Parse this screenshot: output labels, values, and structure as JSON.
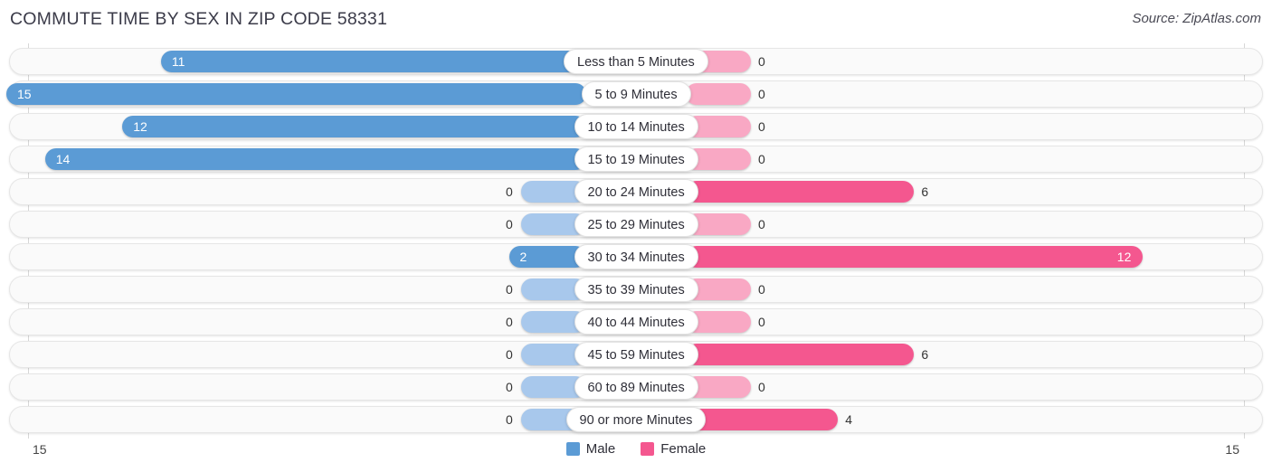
{
  "header": {
    "title": "COMMUTE TIME BY SEX IN ZIP CODE 58331",
    "source": "Source: ZipAtlas.com"
  },
  "legend": {
    "male_label": "Male",
    "female_label": "Female",
    "male_color": "#5B9BD5",
    "female_color": "#F4578F",
    "male_zero_color": "#A8C8EC",
    "female_zero_color": "#F9A8C4"
  },
  "axis": {
    "left_label": "15",
    "right_label": "15",
    "max": 15
  },
  "chart_data": {
    "type": "bar",
    "orientation": "horizontal-diverging",
    "title": "COMMUTE TIME BY SEX IN ZIP CODE 58331",
    "xlabel": "",
    "ylabel": "",
    "xlim": [
      15,
      15
    ],
    "grid": false,
    "legend_position": "bottom-center",
    "categories": [
      "Less than 5 Minutes",
      "5 to 9 Minutes",
      "10 to 14 Minutes",
      "15 to 19 Minutes",
      "20 to 24 Minutes",
      "25 to 29 Minutes",
      "30 to 34 Minutes",
      "35 to 39 Minutes",
      "40 to 44 Minutes",
      "45 to 59 Minutes",
      "60 to 89 Minutes",
      "90 or more Minutes"
    ],
    "series": [
      {
        "name": "Male",
        "values": [
          11,
          15,
          12,
          14,
          0,
          0,
          2,
          0,
          0,
          0,
          0,
          0
        ]
      },
      {
        "name": "Female",
        "values": [
          0,
          0,
          0,
          0,
          6,
          0,
          12,
          0,
          0,
          6,
          0,
          4
        ]
      }
    ]
  },
  "rows": [
    {
      "label": "Less than 5 Minutes",
      "male": "11",
      "female": "0"
    },
    {
      "label": "5 to 9 Minutes",
      "male": "15",
      "female": "0"
    },
    {
      "label": "10 to 14 Minutes",
      "male": "12",
      "female": "0"
    },
    {
      "label": "15 to 19 Minutes",
      "male": "14",
      "female": "0"
    },
    {
      "label": "20 to 24 Minutes",
      "male": "0",
      "female": "6"
    },
    {
      "label": "25 to 29 Minutes",
      "male": "0",
      "female": "0"
    },
    {
      "label": "30 to 34 Minutes",
      "male": "2",
      "female": "12"
    },
    {
      "label": "35 to 39 Minutes",
      "male": "0",
      "female": "0"
    },
    {
      "label": "40 to 44 Minutes",
      "male": "0",
      "female": "0"
    },
    {
      "label": "45 to 59 Minutes",
      "male": "0",
      "female": "6"
    },
    {
      "label": "60 to 89 Minutes",
      "male": "0",
      "female": "0"
    },
    {
      "label": "90 or more Minutes",
      "male": "0",
      "female": "4"
    }
  ]
}
